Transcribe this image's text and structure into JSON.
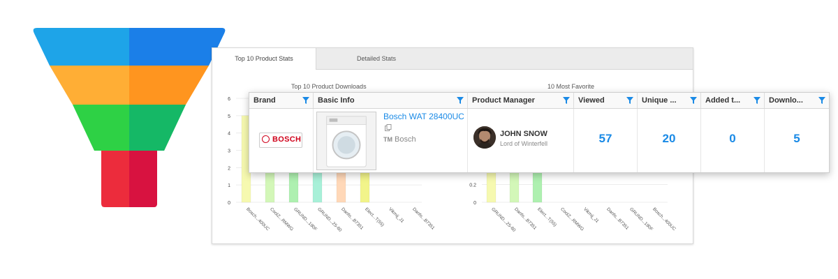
{
  "tabs": [
    {
      "label": "Top 10 Product Stats"
    },
    {
      "label": "Detailed Stats"
    }
  ],
  "colors": {
    "accent": "#1a8ae6",
    "funnel": [
      "#1e90ee",
      "#ffa030",
      "#22c055",
      "#e0203a"
    ]
  },
  "chart_data": [
    {
      "type": "bar",
      "title": "Top 10 Product Downloads",
      "categories": [
        "Bosch...400UC",
        "CoolZ...RMWG",
        "GRUND...190F",
        "GRUND...25-60",
        "Danfo...B7351",
        "Elect...T(55)",
        "Vikmij_J1",
        "Danfo...B7351"
      ],
      "values": [
        5,
        3,
        3,
        2,
        2,
        2,
        0,
        0
      ],
      "yticks": [
        "0",
        "1",
        "2",
        "3",
        "4",
        "5",
        "6"
      ],
      "ylim": [
        0,
        6
      ],
      "bar_colors": [
        "#f6f9b0",
        "#d3f7b8",
        "#aef0b0",
        "#a8f0d8",
        "#ffd8b8",
        "#f2f48a",
        "#e8e8e8",
        "#e8e8e8"
      ]
    },
    {
      "type": "bar",
      "title": "10 Most Favorite",
      "categories": [
        "GRUND...25-60",
        "Danfo...B7351",
        "Elect...T(55)",
        "CoolZ...RMWG",
        "Vikmij_J1",
        "Danfo...B7351",
        "GRUND...190F",
        "Bosch...400UC"
      ],
      "values": [
        1,
        1,
        1,
        0,
        0,
        0,
        0,
        0
      ],
      "yticks": [
        "0",
        "0.2"
      ],
      "ylim": [
        0,
        1
      ],
      "bar_colors": [
        "#f6f9b0",
        "#d3f7b8",
        "#aef0b0",
        "#e8e8e8",
        "#e8e8e8",
        "#e8e8e8",
        "#e8e8e8",
        "#e8e8e8"
      ]
    }
  ],
  "table": {
    "columns": [
      {
        "label": "Brand"
      },
      {
        "label": "Basic Info"
      },
      {
        "label": "Product Manager"
      },
      {
        "label": "Viewed"
      },
      {
        "label": "Unique ..."
      },
      {
        "label": "Added t..."
      },
      {
        "label": "Downlo..."
      }
    ],
    "row": {
      "brand_logo": "BOSCH",
      "product_name": "Bosch WAT 28400UC",
      "brand_text": "Bosch",
      "brand_prefix": "TM",
      "manager_name": "JOHN SNOW",
      "manager_title": "Lord of Winterfell",
      "viewed": "57",
      "unique": "20",
      "added": "0",
      "downloads": "5"
    }
  }
}
